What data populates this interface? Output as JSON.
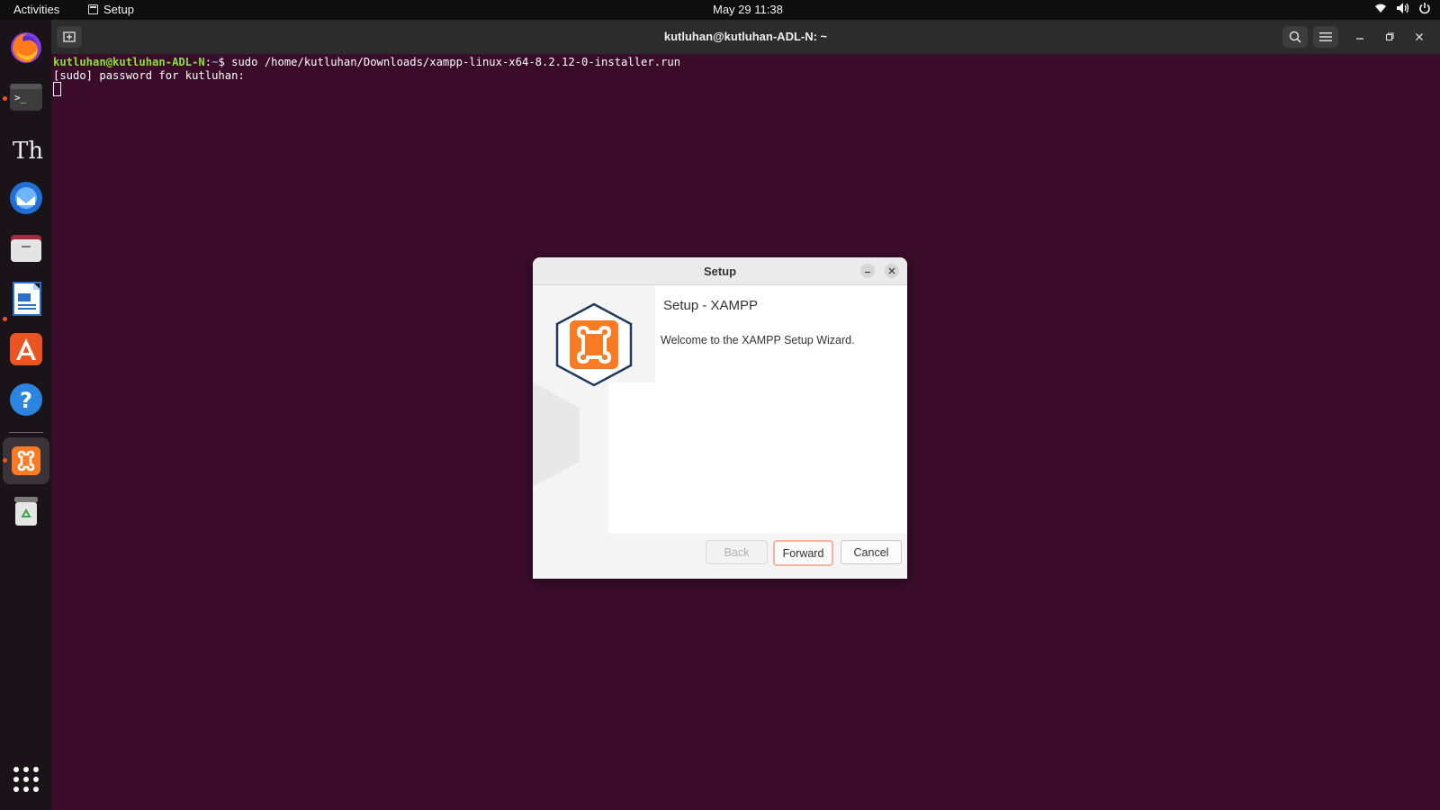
{
  "topbar": {
    "activities": "Activities",
    "app_name": "Setup",
    "clock": "May 29  11:38",
    "tray_icons": [
      "wifi-icon",
      "volume-icon",
      "power-icon"
    ]
  },
  "dock": {
    "items": [
      "firefox",
      "terminal",
      "typora",
      "thunderbird",
      "files",
      "libreoffice-writer",
      "app-center",
      "help",
      "xampp",
      "trash",
      "show-apps"
    ],
    "running": [
      "terminal",
      "libreoffice-writer",
      "xampp"
    ],
    "active": "xampp"
  },
  "terminal": {
    "title": "kutluhan@kutluhan-ADL-N: ~",
    "prompt_user": "kutluhan@kutluhan-ADL-N",
    "prompt_sep": ":",
    "prompt_path": "~",
    "prompt_symbol": "$",
    "command": " sudo /home/kutluhan/Downloads/xampp-linux-x64-8.2.12-0-installer.run",
    "output": "[sudo] password for kutluhan:"
  },
  "dialog": {
    "title": "Setup",
    "heading": "Setup - XAMPP",
    "welcome": "Welcome to the XAMPP Setup Wizard.",
    "buttons": {
      "back": "Back",
      "forward": "Forward",
      "cancel": "Cancel"
    }
  },
  "colors": {
    "terminal_bg": "#3a0c2a",
    "prompt_user": "#8ae234",
    "prompt_path": "#729fcf",
    "accent": "#e95420",
    "xampp_orange": "#fb7a24",
    "xampp_navy": "#1f3b5c"
  }
}
